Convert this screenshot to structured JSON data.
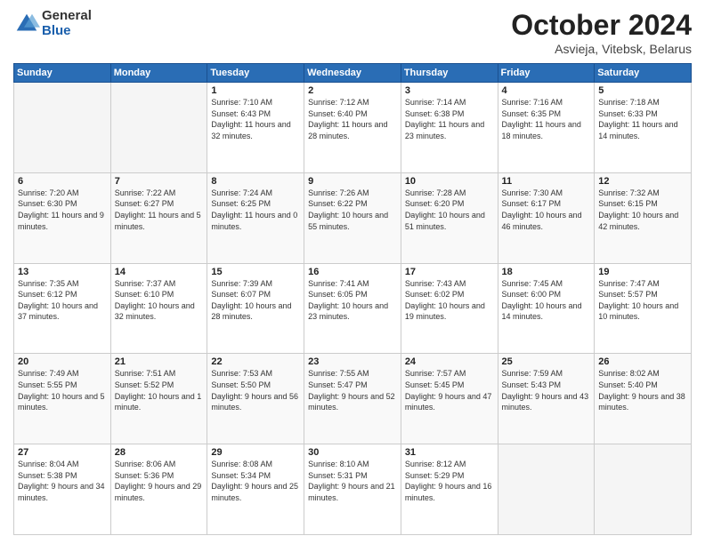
{
  "header": {
    "logo_general": "General",
    "logo_blue": "Blue",
    "month_title": "October 2024",
    "location": "Asvieja, Vitebsk, Belarus"
  },
  "weekdays": [
    "Sunday",
    "Monday",
    "Tuesday",
    "Wednesday",
    "Thursday",
    "Friday",
    "Saturday"
  ],
  "weeks": [
    [
      {
        "day": "",
        "sunrise": "",
        "sunset": "",
        "daylight": ""
      },
      {
        "day": "",
        "sunrise": "",
        "sunset": "",
        "daylight": ""
      },
      {
        "day": "1",
        "sunrise": "Sunrise: 7:10 AM",
        "sunset": "Sunset: 6:43 PM",
        "daylight": "Daylight: 11 hours and 32 minutes."
      },
      {
        "day": "2",
        "sunrise": "Sunrise: 7:12 AM",
        "sunset": "Sunset: 6:40 PM",
        "daylight": "Daylight: 11 hours and 28 minutes."
      },
      {
        "day": "3",
        "sunrise": "Sunrise: 7:14 AM",
        "sunset": "Sunset: 6:38 PM",
        "daylight": "Daylight: 11 hours and 23 minutes."
      },
      {
        "day": "4",
        "sunrise": "Sunrise: 7:16 AM",
        "sunset": "Sunset: 6:35 PM",
        "daylight": "Daylight: 11 hours and 18 minutes."
      },
      {
        "day": "5",
        "sunrise": "Sunrise: 7:18 AM",
        "sunset": "Sunset: 6:33 PM",
        "daylight": "Daylight: 11 hours and 14 minutes."
      }
    ],
    [
      {
        "day": "6",
        "sunrise": "Sunrise: 7:20 AM",
        "sunset": "Sunset: 6:30 PM",
        "daylight": "Daylight: 11 hours and 9 minutes."
      },
      {
        "day": "7",
        "sunrise": "Sunrise: 7:22 AM",
        "sunset": "Sunset: 6:27 PM",
        "daylight": "Daylight: 11 hours and 5 minutes."
      },
      {
        "day": "8",
        "sunrise": "Sunrise: 7:24 AM",
        "sunset": "Sunset: 6:25 PM",
        "daylight": "Daylight: 11 hours and 0 minutes."
      },
      {
        "day": "9",
        "sunrise": "Sunrise: 7:26 AM",
        "sunset": "Sunset: 6:22 PM",
        "daylight": "Daylight: 10 hours and 55 minutes."
      },
      {
        "day": "10",
        "sunrise": "Sunrise: 7:28 AM",
        "sunset": "Sunset: 6:20 PM",
        "daylight": "Daylight: 10 hours and 51 minutes."
      },
      {
        "day": "11",
        "sunrise": "Sunrise: 7:30 AM",
        "sunset": "Sunset: 6:17 PM",
        "daylight": "Daylight: 10 hours and 46 minutes."
      },
      {
        "day": "12",
        "sunrise": "Sunrise: 7:32 AM",
        "sunset": "Sunset: 6:15 PM",
        "daylight": "Daylight: 10 hours and 42 minutes."
      }
    ],
    [
      {
        "day": "13",
        "sunrise": "Sunrise: 7:35 AM",
        "sunset": "Sunset: 6:12 PM",
        "daylight": "Daylight: 10 hours and 37 minutes."
      },
      {
        "day": "14",
        "sunrise": "Sunrise: 7:37 AM",
        "sunset": "Sunset: 6:10 PM",
        "daylight": "Daylight: 10 hours and 32 minutes."
      },
      {
        "day": "15",
        "sunrise": "Sunrise: 7:39 AM",
        "sunset": "Sunset: 6:07 PM",
        "daylight": "Daylight: 10 hours and 28 minutes."
      },
      {
        "day": "16",
        "sunrise": "Sunrise: 7:41 AM",
        "sunset": "Sunset: 6:05 PM",
        "daylight": "Daylight: 10 hours and 23 minutes."
      },
      {
        "day": "17",
        "sunrise": "Sunrise: 7:43 AM",
        "sunset": "Sunset: 6:02 PM",
        "daylight": "Daylight: 10 hours and 19 minutes."
      },
      {
        "day": "18",
        "sunrise": "Sunrise: 7:45 AM",
        "sunset": "Sunset: 6:00 PM",
        "daylight": "Daylight: 10 hours and 14 minutes."
      },
      {
        "day": "19",
        "sunrise": "Sunrise: 7:47 AM",
        "sunset": "Sunset: 5:57 PM",
        "daylight": "Daylight: 10 hours and 10 minutes."
      }
    ],
    [
      {
        "day": "20",
        "sunrise": "Sunrise: 7:49 AM",
        "sunset": "Sunset: 5:55 PM",
        "daylight": "Daylight: 10 hours and 5 minutes."
      },
      {
        "day": "21",
        "sunrise": "Sunrise: 7:51 AM",
        "sunset": "Sunset: 5:52 PM",
        "daylight": "Daylight: 10 hours and 1 minute."
      },
      {
        "day": "22",
        "sunrise": "Sunrise: 7:53 AM",
        "sunset": "Sunset: 5:50 PM",
        "daylight": "Daylight: 9 hours and 56 minutes."
      },
      {
        "day": "23",
        "sunrise": "Sunrise: 7:55 AM",
        "sunset": "Sunset: 5:47 PM",
        "daylight": "Daylight: 9 hours and 52 minutes."
      },
      {
        "day": "24",
        "sunrise": "Sunrise: 7:57 AM",
        "sunset": "Sunset: 5:45 PM",
        "daylight": "Daylight: 9 hours and 47 minutes."
      },
      {
        "day": "25",
        "sunrise": "Sunrise: 7:59 AM",
        "sunset": "Sunset: 5:43 PM",
        "daylight": "Daylight: 9 hours and 43 minutes."
      },
      {
        "day": "26",
        "sunrise": "Sunrise: 8:02 AM",
        "sunset": "Sunset: 5:40 PM",
        "daylight": "Daylight: 9 hours and 38 minutes."
      }
    ],
    [
      {
        "day": "27",
        "sunrise": "Sunrise: 8:04 AM",
        "sunset": "Sunset: 5:38 PM",
        "daylight": "Daylight: 9 hours and 34 minutes."
      },
      {
        "day": "28",
        "sunrise": "Sunrise: 8:06 AM",
        "sunset": "Sunset: 5:36 PM",
        "daylight": "Daylight: 9 hours and 29 minutes."
      },
      {
        "day": "29",
        "sunrise": "Sunrise: 8:08 AM",
        "sunset": "Sunset: 5:34 PM",
        "daylight": "Daylight: 9 hours and 25 minutes."
      },
      {
        "day": "30",
        "sunrise": "Sunrise: 8:10 AM",
        "sunset": "Sunset: 5:31 PM",
        "daylight": "Daylight: 9 hours and 21 minutes."
      },
      {
        "day": "31",
        "sunrise": "Sunrise: 8:12 AM",
        "sunset": "Sunset: 5:29 PM",
        "daylight": "Daylight: 9 hours and 16 minutes."
      },
      {
        "day": "",
        "sunrise": "",
        "sunset": "",
        "daylight": ""
      },
      {
        "day": "",
        "sunrise": "",
        "sunset": "",
        "daylight": ""
      }
    ]
  ]
}
